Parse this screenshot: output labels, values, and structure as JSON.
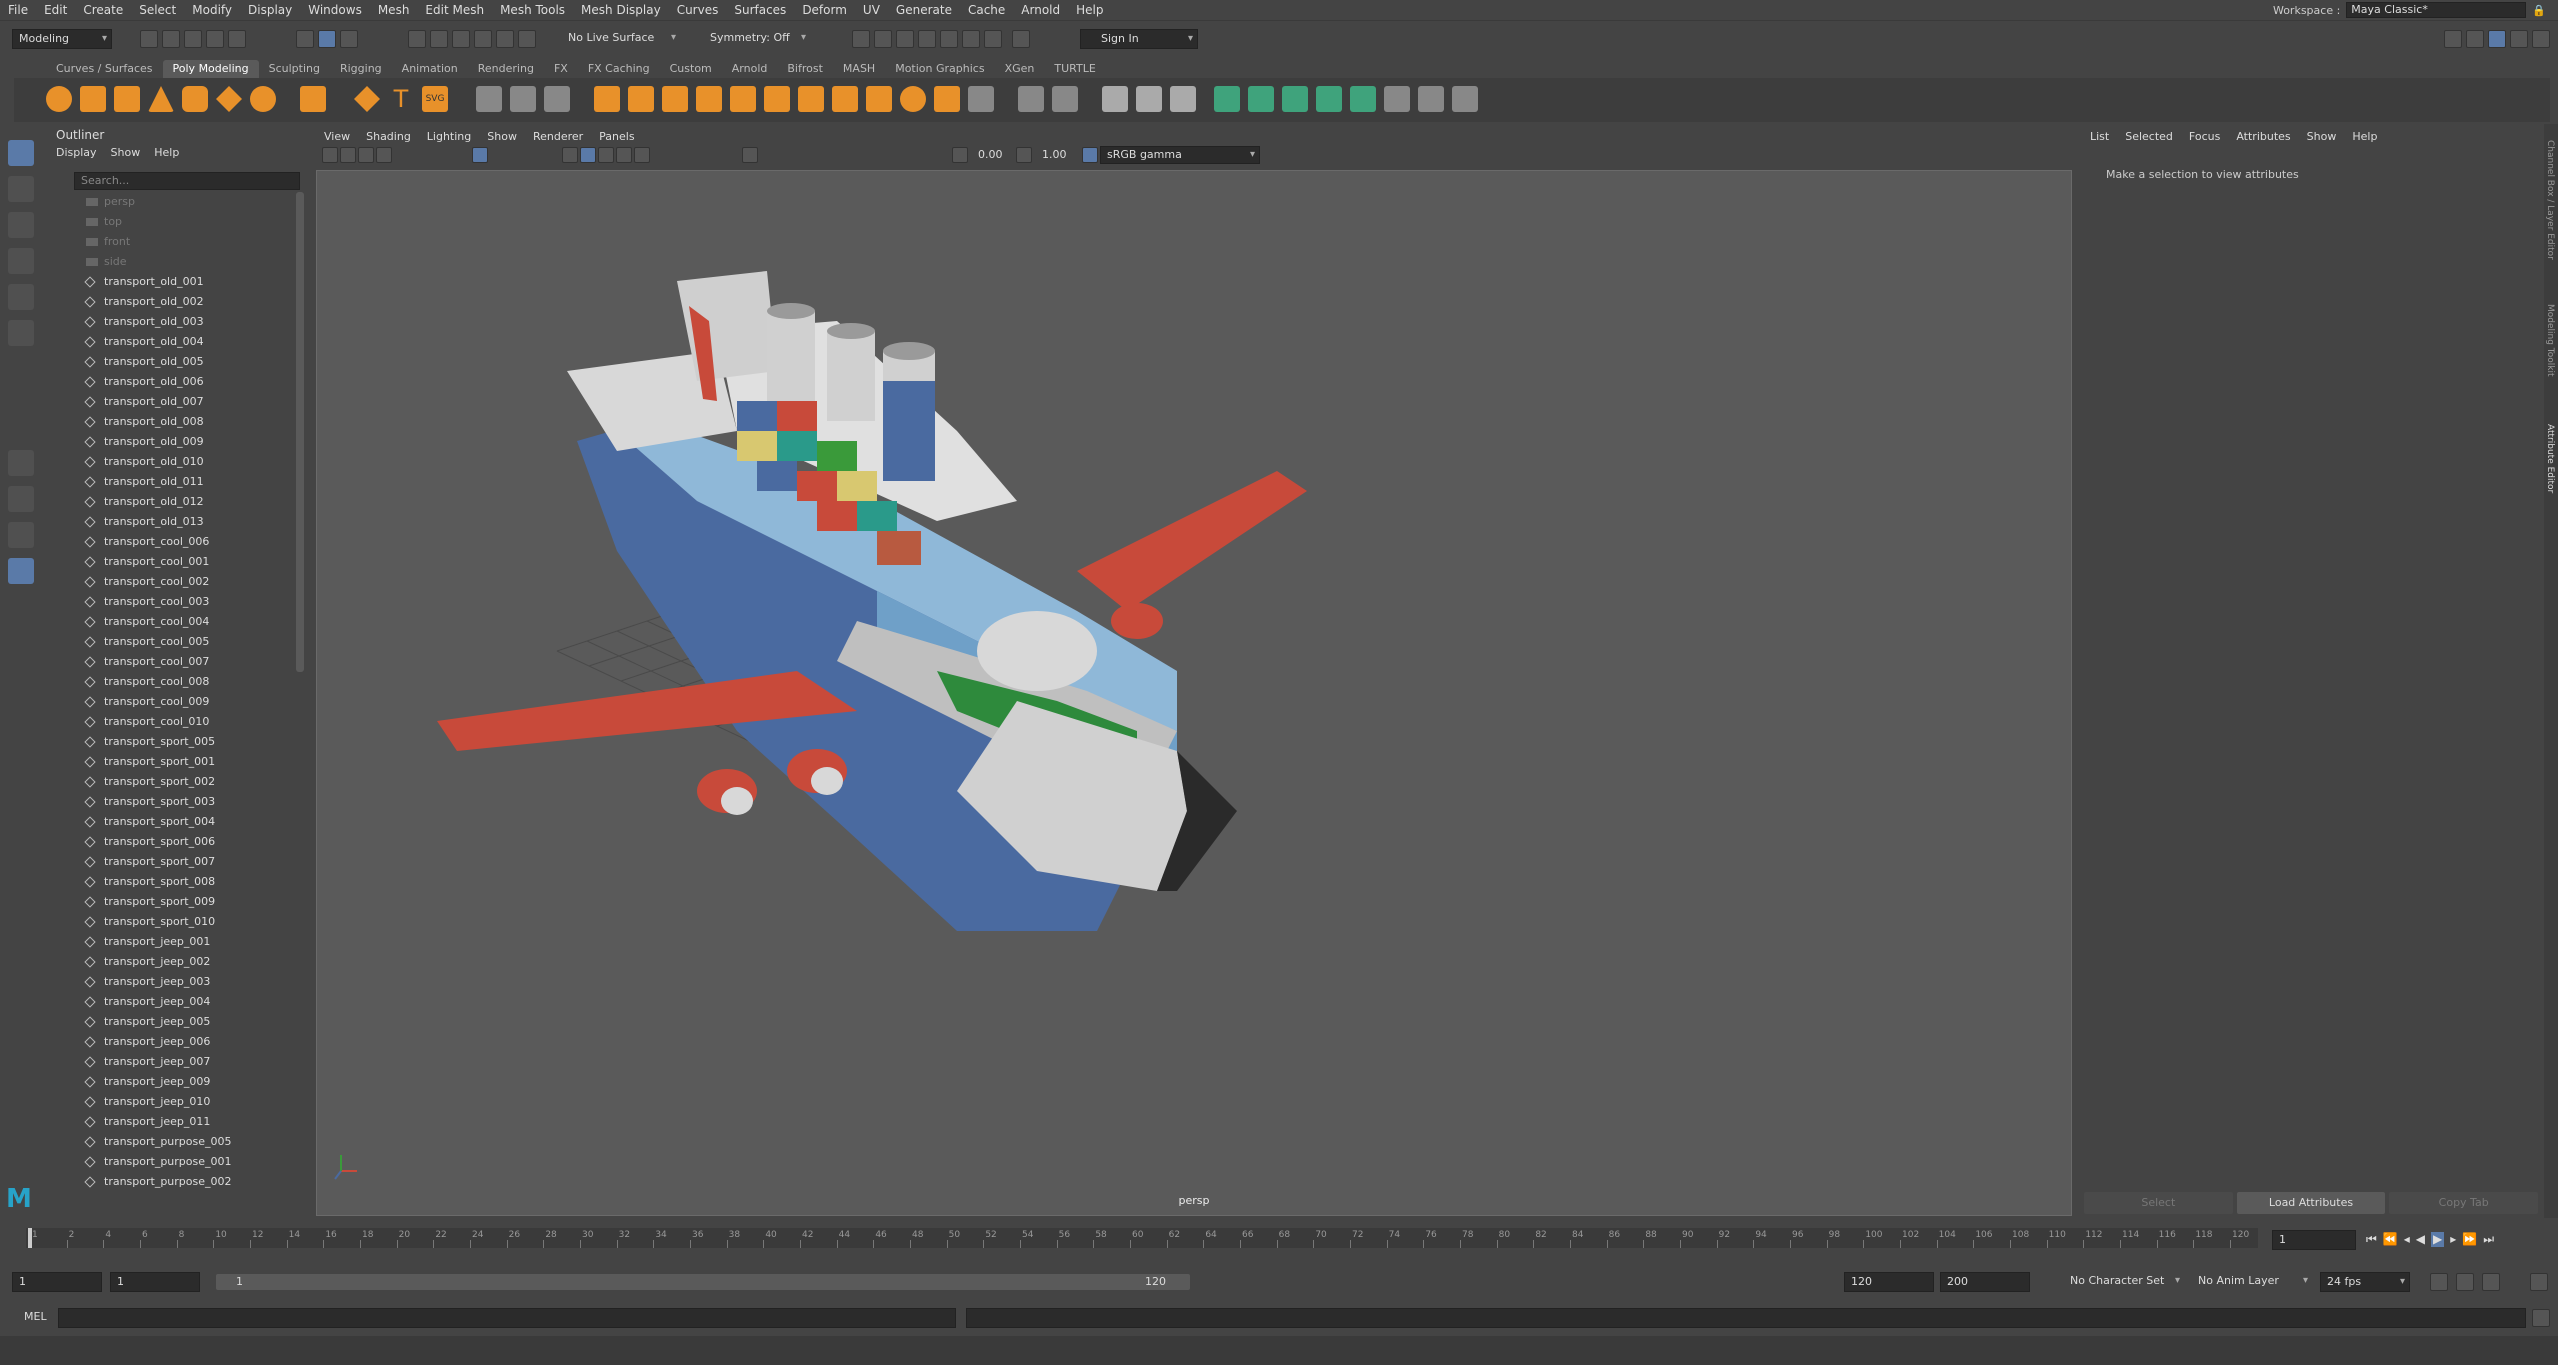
{
  "menubar": [
    "File",
    "Edit",
    "Create",
    "Select",
    "Modify",
    "Display",
    "Windows",
    "Mesh",
    "Edit Mesh",
    "Mesh Tools",
    "Mesh Display",
    "Curves",
    "Surfaces",
    "Deform",
    "UV",
    "Generate",
    "Cache",
    "Arnold",
    "Help"
  ],
  "workspace": {
    "label": "Workspace :",
    "value": "Maya Classic*"
  },
  "status": {
    "mode": "Modeling",
    "live_surface": "No Live Surface",
    "symmetry": "Symmetry: Off",
    "sign_in": "Sign In"
  },
  "shelf_tabs": [
    "Curves / Surfaces",
    "Poly Modeling",
    "Sculpting",
    "Rigging",
    "Animation",
    "Rendering",
    "FX",
    "FX Caching",
    "Custom",
    "Arnold",
    "Bifrost",
    "MASH",
    "Motion Graphics",
    "XGen",
    "TURTLE"
  ],
  "shelf_active": "Poly Modeling",
  "outliner": {
    "title": "Outliner",
    "menu": [
      "Display",
      "Show",
      "Help"
    ],
    "search_placeholder": "Search...",
    "cameras": [
      "persp",
      "top",
      "front",
      "side"
    ],
    "items": [
      "transport_old_001",
      "transport_old_002",
      "transport_old_003",
      "transport_old_004",
      "transport_old_005",
      "transport_old_006",
      "transport_old_007",
      "transport_old_008",
      "transport_old_009",
      "transport_old_010",
      "transport_old_011",
      "transport_old_012",
      "transport_old_013",
      "transport_cool_006",
      "transport_cool_001",
      "transport_cool_002",
      "transport_cool_003",
      "transport_cool_004",
      "transport_cool_005",
      "transport_cool_007",
      "transport_cool_008",
      "transport_cool_009",
      "transport_cool_010",
      "transport_sport_005",
      "transport_sport_001",
      "transport_sport_002",
      "transport_sport_003",
      "transport_sport_004",
      "transport_sport_006",
      "transport_sport_007",
      "transport_sport_008",
      "transport_sport_009",
      "transport_sport_010",
      "transport_jeep_001",
      "transport_jeep_002",
      "transport_jeep_003",
      "transport_jeep_004",
      "transport_jeep_005",
      "transport_jeep_006",
      "transport_jeep_007",
      "transport_jeep_009",
      "transport_jeep_010",
      "transport_jeep_011",
      "transport_purpose_005",
      "transport_purpose_001",
      "transport_purpose_002"
    ]
  },
  "viewport": {
    "menu": [
      "View",
      "Shading",
      "Lighting",
      "Show",
      "Renderer",
      "Panels"
    ],
    "exposure": "0.00",
    "gamma": "1.00",
    "colorspace": "sRGB gamma",
    "camera_label": "persp"
  },
  "attribute_editor": {
    "menu": [
      "List",
      "Selected",
      "Focus",
      "Attributes",
      "Show",
      "Help"
    ],
    "message": "Make a selection to view attributes",
    "buttons": [
      "Select",
      "Load Attributes",
      "Copy Tab"
    ]
  },
  "side_tabs": [
    "Channel Box / Layer Editor",
    "Modeling Toolkit",
    "Attribute Editor"
  ],
  "timeline": {
    "ticks": [
      "1",
      "2",
      "4",
      "6",
      "8",
      "10",
      "12",
      "14",
      "16",
      "18",
      "20",
      "22",
      "24",
      "26",
      "28",
      "30",
      "32",
      "34",
      "36",
      "38",
      "40",
      "42",
      "44",
      "46",
      "48",
      "50",
      "52",
      "54",
      "56",
      "58",
      "60",
      "62",
      "64",
      "66",
      "68",
      "70",
      "72",
      "74",
      "76",
      "78",
      "80",
      "82",
      "84",
      "86",
      "88",
      "90",
      "92",
      "94",
      "96",
      "98",
      "100",
      "102",
      "104",
      "106",
      "108",
      "110",
      "112",
      "114",
      "116",
      "118",
      "120"
    ],
    "current_frame": "1"
  },
  "range": {
    "start": "1",
    "anim_start": "1",
    "range_start_label": "1",
    "range_end_label": "120",
    "anim_end": "120",
    "end": "200",
    "character_set": "No Character Set",
    "anim_layer": "No Anim Layer",
    "fps": "24 fps"
  },
  "cmd": {
    "lang": "MEL"
  }
}
